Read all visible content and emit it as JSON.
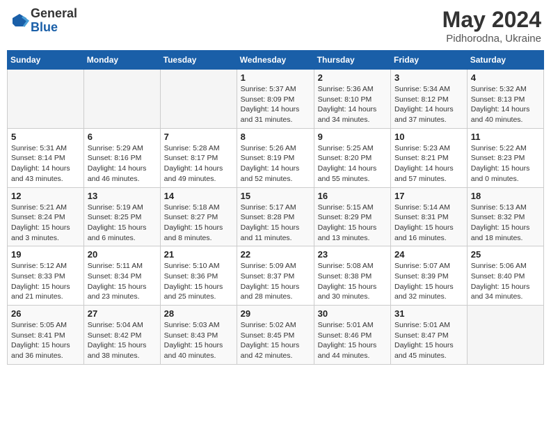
{
  "header": {
    "logo_general": "General",
    "logo_blue": "Blue",
    "month_year": "May 2024",
    "location": "Pidhorodna, Ukraine"
  },
  "days_of_week": [
    "Sunday",
    "Monday",
    "Tuesday",
    "Wednesday",
    "Thursday",
    "Friday",
    "Saturday"
  ],
  "weeks": [
    [
      {
        "day": "",
        "info": ""
      },
      {
        "day": "",
        "info": ""
      },
      {
        "day": "",
        "info": ""
      },
      {
        "day": "1",
        "info": "Sunrise: 5:37 AM\nSunset: 8:09 PM\nDaylight: 14 hours\nand 31 minutes."
      },
      {
        "day": "2",
        "info": "Sunrise: 5:36 AM\nSunset: 8:10 PM\nDaylight: 14 hours\nand 34 minutes."
      },
      {
        "day": "3",
        "info": "Sunrise: 5:34 AM\nSunset: 8:12 PM\nDaylight: 14 hours\nand 37 minutes."
      },
      {
        "day": "4",
        "info": "Sunrise: 5:32 AM\nSunset: 8:13 PM\nDaylight: 14 hours\nand 40 minutes."
      }
    ],
    [
      {
        "day": "5",
        "info": "Sunrise: 5:31 AM\nSunset: 8:14 PM\nDaylight: 14 hours\nand 43 minutes."
      },
      {
        "day": "6",
        "info": "Sunrise: 5:29 AM\nSunset: 8:16 PM\nDaylight: 14 hours\nand 46 minutes."
      },
      {
        "day": "7",
        "info": "Sunrise: 5:28 AM\nSunset: 8:17 PM\nDaylight: 14 hours\nand 49 minutes."
      },
      {
        "day": "8",
        "info": "Sunrise: 5:26 AM\nSunset: 8:19 PM\nDaylight: 14 hours\nand 52 minutes."
      },
      {
        "day": "9",
        "info": "Sunrise: 5:25 AM\nSunset: 8:20 PM\nDaylight: 14 hours\nand 55 minutes."
      },
      {
        "day": "10",
        "info": "Sunrise: 5:23 AM\nSunset: 8:21 PM\nDaylight: 14 hours\nand 57 minutes."
      },
      {
        "day": "11",
        "info": "Sunrise: 5:22 AM\nSunset: 8:23 PM\nDaylight: 15 hours\nand 0 minutes."
      }
    ],
    [
      {
        "day": "12",
        "info": "Sunrise: 5:21 AM\nSunset: 8:24 PM\nDaylight: 15 hours\nand 3 minutes."
      },
      {
        "day": "13",
        "info": "Sunrise: 5:19 AM\nSunset: 8:25 PM\nDaylight: 15 hours\nand 6 minutes."
      },
      {
        "day": "14",
        "info": "Sunrise: 5:18 AM\nSunset: 8:27 PM\nDaylight: 15 hours\nand 8 minutes."
      },
      {
        "day": "15",
        "info": "Sunrise: 5:17 AM\nSunset: 8:28 PM\nDaylight: 15 hours\nand 11 minutes."
      },
      {
        "day": "16",
        "info": "Sunrise: 5:15 AM\nSunset: 8:29 PM\nDaylight: 15 hours\nand 13 minutes."
      },
      {
        "day": "17",
        "info": "Sunrise: 5:14 AM\nSunset: 8:31 PM\nDaylight: 15 hours\nand 16 minutes."
      },
      {
        "day": "18",
        "info": "Sunrise: 5:13 AM\nSunset: 8:32 PM\nDaylight: 15 hours\nand 18 minutes."
      }
    ],
    [
      {
        "day": "19",
        "info": "Sunrise: 5:12 AM\nSunset: 8:33 PM\nDaylight: 15 hours\nand 21 minutes."
      },
      {
        "day": "20",
        "info": "Sunrise: 5:11 AM\nSunset: 8:34 PM\nDaylight: 15 hours\nand 23 minutes."
      },
      {
        "day": "21",
        "info": "Sunrise: 5:10 AM\nSunset: 8:36 PM\nDaylight: 15 hours\nand 25 minutes."
      },
      {
        "day": "22",
        "info": "Sunrise: 5:09 AM\nSunset: 8:37 PM\nDaylight: 15 hours\nand 28 minutes."
      },
      {
        "day": "23",
        "info": "Sunrise: 5:08 AM\nSunset: 8:38 PM\nDaylight: 15 hours\nand 30 minutes."
      },
      {
        "day": "24",
        "info": "Sunrise: 5:07 AM\nSunset: 8:39 PM\nDaylight: 15 hours\nand 32 minutes."
      },
      {
        "day": "25",
        "info": "Sunrise: 5:06 AM\nSunset: 8:40 PM\nDaylight: 15 hours\nand 34 minutes."
      }
    ],
    [
      {
        "day": "26",
        "info": "Sunrise: 5:05 AM\nSunset: 8:41 PM\nDaylight: 15 hours\nand 36 minutes."
      },
      {
        "day": "27",
        "info": "Sunrise: 5:04 AM\nSunset: 8:42 PM\nDaylight: 15 hours\nand 38 minutes."
      },
      {
        "day": "28",
        "info": "Sunrise: 5:03 AM\nSunset: 8:43 PM\nDaylight: 15 hours\nand 40 minutes."
      },
      {
        "day": "29",
        "info": "Sunrise: 5:02 AM\nSunset: 8:45 PM\nDaylight: 15 hours\nand 42 minutes."
      },
      {
        "day": "30",
        "info": "Sunrise: 5:01 AM\nSunset: 8:46 PM\nDaylight: 15 hours\nand 44 minutes."
      },
      {
        "day": "31",
        "info": "Sunrise: 5:01 AM\nSunset: 8:47 PM\nDaylight: 15 hours\nand 45 minutes."
      },
      {
        "day": "",
        "info": ""
      }
    ]
  ]
}
